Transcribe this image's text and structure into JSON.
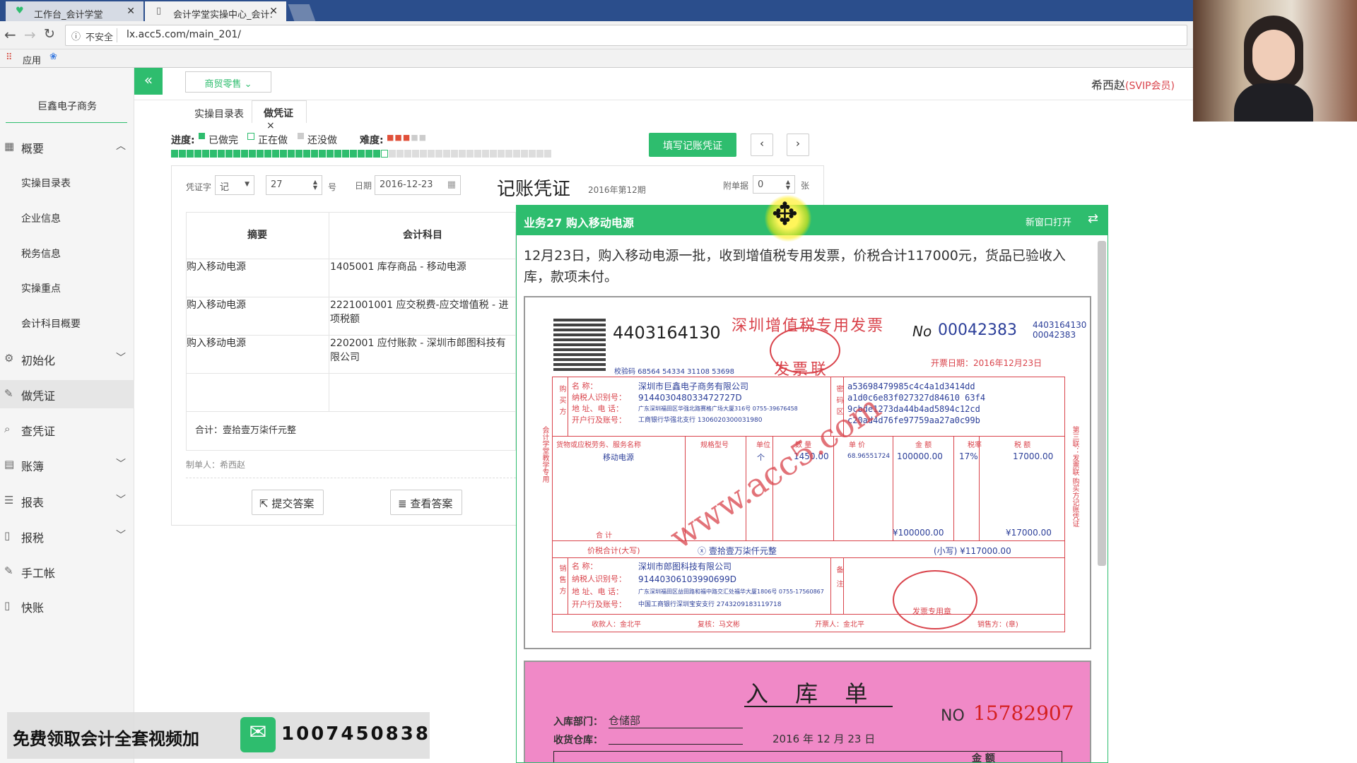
{
  "browser": {
    "tabs": [
      {
        "title": "工作台_会计学堂"
      },
      {
        "title": "会计学堂实操中心_会计:"
      }
    ],
    "security": "不安全",
    "url": "lx.acc5.com/main_201/",
    "bookmarks": {
      "apps": "应用"
    }
  },
  "app": {
    "company": "巨鑫电子商务",
    "industry": "商贸零售",
    "user": {
      "name": "希西赵",
      "level": "(SVIP会员)"
    }
  },
  "sidebar": {
    "overview": "概要",
    "sub": [
      "实操目录表",
      "企业信息",
      "税务信息",
      "实操重点",
      "会计科目概要"
    ],
    "items": [
      {
        "label": "初始化"
      },
      {
        "label": "做凭证"
      },
      {
        "label": "查凭证"
      },
      {
        "label": "账簿"
      },
      {
        "label": "报表"
      },
      {
        "label": "报税"
      },
      {
        "label": "手工帐"
      },
      {
        "label": "快账"
      }
    ]
  },
  "tabs": {
    "t1": "实操目录表",
    "t2": "做凭证"
  },
  "progress": {
    "label": "进度:",
    "done": "已做完",
    "doing": "正在做",
    "todo": "还没做",
    "difficulty_label": "难度:",
    "difficulty": 3,
    "difficulty_max": 5,
    "done_count": 27,
    "total": 49
  },
  "buttons": {
    "fill": "填写记账凭证",
    "submit": "提交答案",
    "view": "查看答案"
  },
  "voucher": {
    "word_label": "凭证字",
    "word": "记",
    "number": "27",
    "number_unit": "号",
    "date_label": "日期",
    "date": "2016-12-23",
    "title": "记账凭证",
    "period": "2016年第12期",
    "attach_label": "附单据",
    "attach": "0",
    "attach_unit": "张",
    "col_summary": "摘要",
    "col_account": "会计科目",
    "rows": [
      {
        "summary": "购入移动电源",
        "account": "1405001 库存商品 - 移动电源"
      },
      {
        "summary": "购入移动电源",
        "account": "2221001001 应交税费-应交增值税 - 进项税额"
      },
      {
        "summary": "购入移动电源",
        "account": "2202001 应付账款 - 深圳市郎图科技有限公司"
      }
    ],
    "total": "合计：壹拾壹万柒仟元整",
    "maker": "制单人：希西赵"
  },
  "business": {
    "title": "业务27 购入移动电源",
    "open_new": "新窗口打开",
    "desc": "12月23日，购入移动电源一批，收到增值税专用发票，价税合计117000元，货品已验收入库，款项未付。"
  },
  "invoice": {
    "code": "4403164130",
    "title": "深圳增值税专用发票",
    "sub": "发票联",
    "no_label": "No",
    "no": "00042383",
    "code_small": "4403164130",
    "no_small": "00042383",
    "date": "开票日期：2016年12月23日",
    "check": "校验码 68564 54334 31108 53698",
    "buyer": {
      "name": "深圳市巨鑫电子商务有限公司",
      "tax": "914403048033472727D",
      "addr": "广东深圳福田区华强北路赛格广场大厦316号 0755-39676458",
      "bank": "工商银行华强北支行 1306020300031980"
    },
    "cipher": [
      "a53698479985c4c4a1d3414dd",
      "a1d0c6e83f027327d84610 63f4",
      "9cbde1273da44b4ad5894c12cd",
      "c20ad4d76fe97759aa27a0c99b"
    ],
    "item": {
      "name": "移动电源",
      "unit": "个",
      "qty": "1450.00",
      "price": "68.96551724",
      "amount": "100000.00",
      "rate": "17%",
      "tax": "17000.00"
    },
    "sum_amount": "¥100000.00",
    "sum_tax": "¥17000.00",
    "total_cn": "ⓧ 壹拾壹万柒仟元整",
    "total_num": "(小写) ¥117000.00",
    "seller": {
      "name": "深圳市郎图科技有限公司",
      "tax": "91440306103990699D",
      "addr": "广东深圳福田区益田路和福中路交汇处福华大厦1806号 0755-17560867",
      "bank": "中国工商银行深圳宝安支行 2743209183119718"
    },
    "payee": "收款人：金北平",
    "review": "复核：马文彬",
    "drawer": "开票人：金北平",
    "seal": "发票专用章",
    "watermark": "www.acc5.com",
    "labels": {
      "total_label": "价税合计(大写)",
      "sum_label": "合 计",
      "goods_label": "货物或应税劳务、服务名称",
      "spec": "规格型号",
      "unit": "单位",
      "qty": "数 量",
      "price": "单 价",
      "amount": "金 额",
      "rate": "税率",
      "tax": "税 额",
      "buyer_side": "购买方",
      "seller_side": "销售方",
      "password": "密码区",
      "remark": "备注",
      "name_l": "名 称：",
      "tax_l": "纳税人识别号：",
      "addr_l": "地 址、电 话：",
      "bank_l": "开户行及账号：",
      "side_text": "第三联：发票联 购买方记账凭证",
      "learn": "会计学堂教学专用",
      "sales_party": "销售方：(章)"
    }
  },
  "receipt": {
    "title": "入 库 单",
    "dept_label": "入库部门：",
    "dept": "仓储部",
    "wh_label": "收货仓库：",
    "date": "2016 年 12 月 23 日",
    "no_label": "NO",
    "no": "15782907",
    "amount_col": "金 额"
  },
  "promo": {
    "text": "免费领取会计全套视频加",
    "number": "1007450838"
  }
}
